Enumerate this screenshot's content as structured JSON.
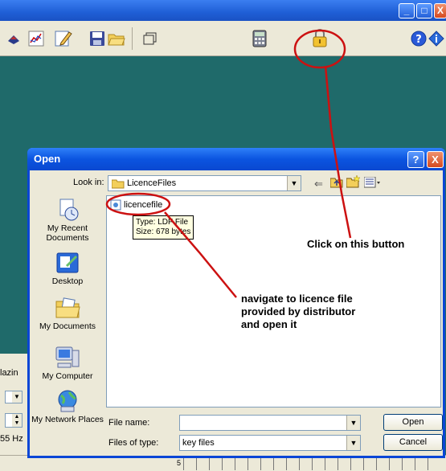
{
  "app": {
    "window_buttons": [
      "_",
      "□",
      "X"
    ],
    "left_partial_labels": [
      "lazin",
      "55 Hz"
    ],
    "axis_fragment": "5"
  },
  "toolbar": {
    "icons": [
      "pen-tool-icon",
      "chart-icon",
      "edit-icon",
      "save-icon",
      "open-folder-icon",
      "window-icon",
      "calculator-icon",
      "padlock-icon",
      "help-icon",
      "info-icon"
    ]
  },
  "dialog": {
    "title": "Open",
    "help_btn": "?",
    "close_btn": "X",
    "look_in_label": "Look in:",
    "look_in_value": "LicenceFiles",
    "places": [
      {
        "label": "My Recent Documents",
        "icon": "recent-documents-icon"
      },
      {
        "label": "Desktop",
        "icon": "desktop-icon"
      },
      {
        "label": "My Documents",
        "icon": "my-documents-icon"
      },
      {
        "label": "My Computer",
        "icon": "my-computer-icon"
      },
      {
        "label": "My Network Places",
        "icon": "network-places-icon"
      }
    ],
    "files": [
      {
        "name": "licencefile"
      }
    ],
    "tooltip": {
      "type": "Type: LDF File",
      "size": "Size: 678 bytes"
    },
    "file_name_label": "File name:",
    "file_name_value": "",
    "files_of_type_label": "Files of type:",
    "files_of_type_value": "key files",
    "open_btn": "Open",
    "cancel_btn": "Cancel"
  },
  "annotations": {
    "button_note": "Click on this button",
    "file_note_lines": [
      "navigate to licence file",
      "provided by distributor",
      "and open it"
    ]
  },
  "colors": {
    "annotation_red": "#cc1111",
    "xp_blue": "#0a46d6",
    "teal_bg": "#1f6a6a"
  }
}
